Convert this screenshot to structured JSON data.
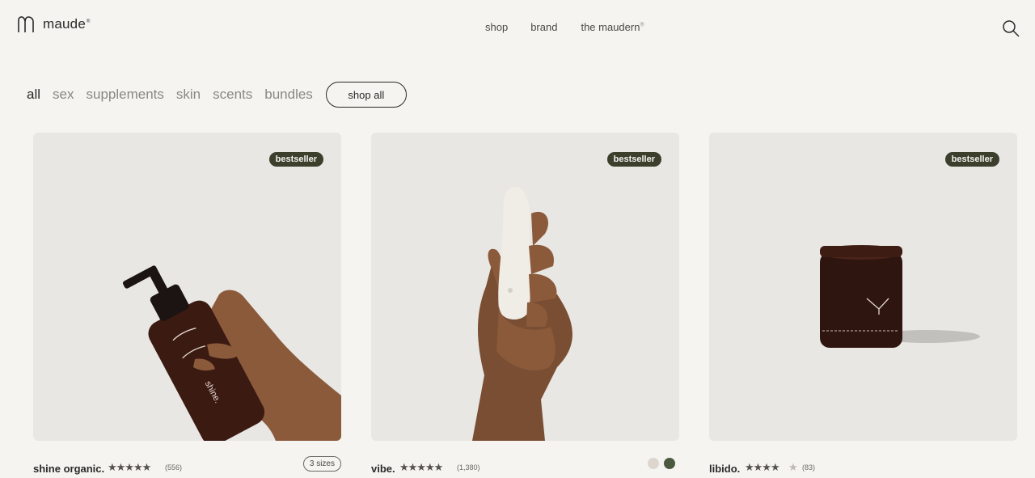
{
  "brand": {
    "name": "maude",
    "mark": "®"
  },
  "nav": {
    "items": [
      "shop",
      "brand",
      "the maudern"
    ],
    "maudern_mark": "®"
  },
  "filters": {
    "categories": [
      "all",
      "sex",
      "supplements",
      "skin",
      "scents",
      "bundles"
    ],
    "active": "all",
    "shop_all_label": "shop all"
  },
  "products": [
    {
      "name": "shine organic.",
      "badge": "bestseller",
      "rating": 5,
      "stars": "★★★★★",
      "review_count": "(556)",
      "option_label": "3 sizes"
    },
    {
      "name": "vibe.",
      "badge": "bestseller",
      "rating": 5,
      "stars": "★★★★★",
      "review_count": "(1,380)",
      "swatches": [
        "#dcd6cf",
        "#4b5a3f"
      ]
    },
    {
      "name": "libido.",
      "badge": "bestseller",
      "rating": 4.5,
      "stars": "★★★★",
      "review_count": "(83)"
    }
  ],
  "colors": {
    "background": "#f5f4f1",
    "badge": "#3b3f2c",
    "card": "#e9e7e3"
  }
}
